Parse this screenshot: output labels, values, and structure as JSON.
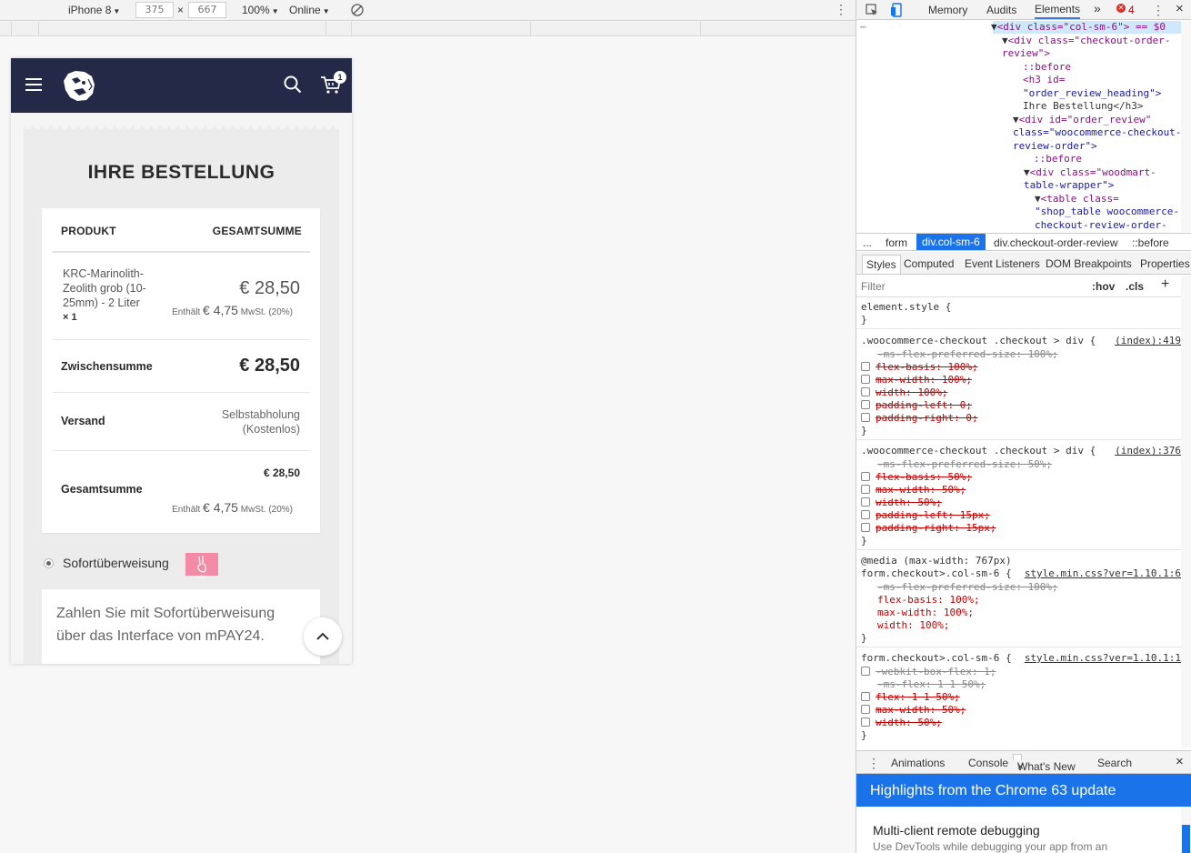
{
  "device_toolbar": {
    "device": "iPhone 8",
    "width": "375",
    "times": "×",
    "height": "667",
    "zoom": "100%",
    "network": "Online"
  },
  "site": {
    "cart_count": "1",
    "order_heading": "IHRE BESTELLUNG",
    "table_headers": {
      "product": "PRODUKT",
      "total": "GESAMTSUMME"
    },
    "product": {
      "name": "KRC-Marinolith-Zeolith grob (10-25mm) - 2 Liter",
      "qty": "× 1",
      "price": "€ 28,50",
      "tax_prefix": "Enthält",
      "tax_amount": "€ 4,75",
      "tax_suffix": "MwSt. (20%)"
    },
    "subtotal": {
      "label": "Zwischensumme",
      "value": "€ 28,50"
    },
    "shipping": {
      "label": "Versand",
      "value": "Selbstabholung (Kostenlos)"
    },
    "total": {
      "label": "Gesamtsumme",
      "value": "€ 28,50",
      "tax_prefix": "Enthält",
      "tax_amount": "€ 4,75",
      "tax_suffix": "MwSt. (20%)"
    },
    "payment": {
      "method": "Sofortüberweisung",
      "logo_text": "sofort",
      "description": "Zahlen Sie mit Sofortüberweisung über das Interface von mPAY24."
    }
  },
  "devtools": {
    "tabs": [
      "Memory",
      "Audits",
      "Elements"
    ],
    "more": "»",
    "error_count": "4",
    "tree": {
      "l1a": "<div class=\"col-sm-6\"> == $0",
      "l2": "<div class=\"checkout-order-",
      "l3": "review\">",
      "l4": "::before",
      "l5": "<h3 id=",
      "l6": "\"order_review_heading\">",
      "l7": "Ihre Bestellung</h3>",
      "l8": "<div id=\"order_review\"",
      "l9": "class=\"woocommerce-checkout-",
      "l10": "review-order\">",
      "l11": "::before",
      "l12": "<div class=\"woodmart-",
      "l13": "table-wrapper\">",
      "l14": "<table class=",
      "l15": "\"shop_table woocommerce-",
      "l16": "checkout-review-order-"
    },
    "breadcrumb": [
      "...",
      "form",
      "div.col-sm-6",
      "div.checkout-order-review",
      "::before"
    ],
    "sub_tabs": [
      "Styles",
      "Computed",
      "Event Listeners",
      "DOM Breakpoints",
      "Properties"
    ],
    "filter": {
      "placeholder": "Filter",
      "hov": ":hov",
      "cls": ".cls",
      "plus": "+"
    },
    "rules": {
      "r0_sel": "element.style {",
      "r0_close": "}",
      "r1_sel": ".woocommerce-checkout .checkout > div {",
      "r1_src": "(index):419",
      "r1_p0": "-ms-flex-preferred-size: 100%;",
      "r1_p1": "flex-basis: 100%;",
      "r1_p2": "max-width: 100%;",
      "r1_p3": "width: 100%;",
      "r1_p4": "padding-left: 0;",
      "r1_p5": "padding-right: 0;",
      "r1_close": "}",
      "r2_sel": ".woocommerce-checkout .checkout > div {",
      "r2_src": "(index):376",
      "r2_p0": "-ms-flex-preferred-size: 50%;",
      "r2_p1": "flex-basis: 50%;",
      "r2_p2": "max-width: 50%;",
      "r2_p3": "width: 50%;",
      "r2_p4": "padding-left: 15px;",
      "r2_p5": "padding-right: 15px;",
      "r2_close": "}",
      "r3_media": "@media (max-width: 767px)",
      "r3_sel": "form.checkout>.col-sm-6 {",
      "r3_src": "style.min.css?ver=1.10.1:6",
      "r3_p0": "-ms-flex-preferred-size: 100%;",
      "r3_p1": "flex-basis: 100%;",
      "r3_p2": "max-width: 100%;",
      "r3_p3": "width: 100%;",
      "r3_close": "}",
      "r4_sel": "form.checkout>.col-sm-6 {",
      "r4_src": "style.min.css?ver=1.10.1:1",
      "r4_p0": "-webkit-box-flex: 1;",
      "r4_p1": "-ms-flex: 1 1 50%;",
      "r4_p2": "flex: 1 1 50%;",
      "r4_p3": "max-width: 50%;",
      "r4_p4": "width: 50%;",
      "r4_close": "}"
    },
    "drawer_tabs": [
      "Animations",
      "Console",
      "What's New",
      "Search"
    ],
    "whats_new_close": "×",
    "close": "×",
    "banner": "Highlights from the Chrome 63 update",
    "feature_title": "Multi-client remote debugging",
    "feature_sub": "Use DevTools while debugging your app from an"
  }
}
